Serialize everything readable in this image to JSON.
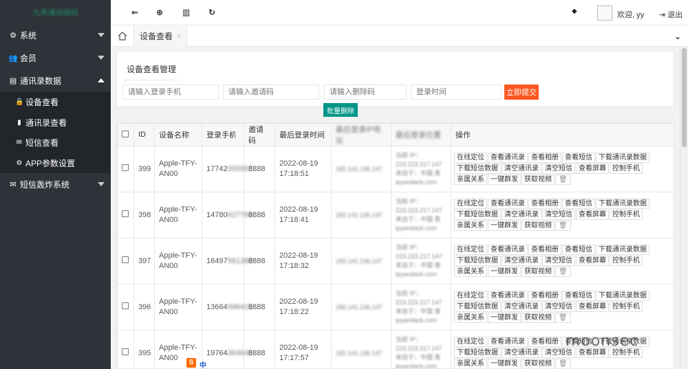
{
  "sidebar": {
    "logo": "九秀通讯接码",
    "items": [
      {
        "icon": "gear-icon",
        "glyph": "⚙",
        "label": "系统"
      },
      {
        "icon": "users-icon",
        "glyph": "👥",
        "label": "会员"
      },
      {
        "icon": "card-icon",
        "glyph": "▤",
        "label": "通讯录数据"
      },
      {
        "icon": "mail-icon",
        "glyph": "✉",
        "label": "短信轰炸系统"
      }
    ],
    "subitems": [
      {
        "icon": "lock-icon",
        "glyph": "🔒",
        "label": "设备查看"
      },
      {
        "icon": "book-icon",
        "glyph": "▮",
        "label": "通讯录查看"
      },
      {
        "icon": "mail-icon",
        "glyph": "✉",
        "label": "短信查看"
      },
      {
        "icon": "gear-icon",
        "glyph": "⚙",
        "label": "APP参数设置"
      }
    ]
  },
  "topbar": {
    "back_glyph": "⇐",
    "target_glyph": "⊕",
    "bank_glyph": "▥",
    "refresh_glyph": "↻",
    "tag_glyph": "◆",
    "welcome": "欢迎, yy",
    "logout": "退出",
    "logout_glyph": "⇥"
  },
  "tabs": {
    "active": "设备查看",
    "close": "×",
    "more_glyph": "⌄"
  },
  "panel": {
    "title": "设备查看管理",
    "ph_phone": "请输入登录手机",
    "ph_invite": "请输入邀请码",
    "ph_delete": "请输入删除码",
    "ph_time": "登录时间",
    "submit": "立即提交",
    "batch_delete": "批量删除"
  },
  "table": {
    "headers": [
      "ID",
      "设备名称",
      "登录手机",
      "邀请码",
      "最后登录时间",
      "最后登录IP地址",
      "最后登录位置",
      "操作"
    ],
    "actions_row1": [
      "在线定位",
      "查看通讯录",
      "查看相册",
      "查看短信",
      "下载通讯录数据"
    ],
    "actions_row2": [
      "下载短信数据",
      "清空通讯录",
      "清空短信",
      "查看屏幕",
      "控制手机",
      "亲属关系"
    ],
    "actions_row3": [
      "一键群发",
      "获取视频"
    ],
    "rows": [
      {
        "id": "399",
        "device": "Apple-TFY-AN00",
        "phone": "17742",
        "phone_hidden": "055567",
        "invite": "8888",
        "date": "2022-08-19",
        "time": "17:18:51",
        "ip": "182.141.136.147",
        "loc1": "当前 IP：",
        "loc2": "223.223.217.147",
        "loc3": "来自于：中国 香",
        "loc4": "ipyandack.com"
      },
      {
        "id": "398",
        "device": "Apple-TFY-AN00",
        "phone": "14780",
        "phone_hidden": "627766",
        "invite": "8888",
        "date": "2022-08-19",
        "time": "17:18:41",
        "ip": "182.141.136.147",
        "loc1": "当前 IP：",
        "loc2": "223.223.217.147",
        "loc3": "来自于：中国 香",
        "loc4": "ipyandack.com"
      },
      {
        "id": "397",
        "device": "Apple-TFY-AN00",
        "phone": "16497",
        "phone_hidden": "561388",
        "invite": "8888",
        "date": "2022-08-19",
        "time": "17:18:32",
        "ip": "182.141.136.147",
        "loc1": "当前 IP：",
        "loc2": "223.223.217.147",
        "loc3": "来自于：中国 香",
        "loc4": "ipyandack.com"
      },
      {
        "id": "396",
        "device": "Apple-TFY-AN00",
        "phone": "13664",
        "phone_hidden": "996415",
        "invite": "8888",
        "date": "2022-08-19",
        "time": "17:18:22",
        "ip": "182.141.136.147",
        "loc1": "当前 IP：",
        "loc2": "223.223.217.147",
        "loc3": "来自于：中国 香",
        "loc4": "ipyandack.com"
      },
      {
        "id": "395",
        "device": "Apple-TFY-AN00",
        "phone": "19764",
        "phone_hidden": "364640",
        "invite": "8888",
        "date": "2022-08-19",
        "time": "17:17:57",
        "ip": "182.141.136.147",
        "loc1": "当前 IP：",
        "loc2": "223.223.217.147",
        "loc3": "来自于：中国 香",
        "loc4": "ipyandack.com"
      }
    ]
  },
  "overlay": {
    "ime_icon": "S",
    "ime_lang": "中",
    "watermark": "moonsec"
  },
  "colors": {
    "sidebar_bg": "#2f3238",
    "submit": "#ff5722",
    "batch": "#009688"
  }
}
